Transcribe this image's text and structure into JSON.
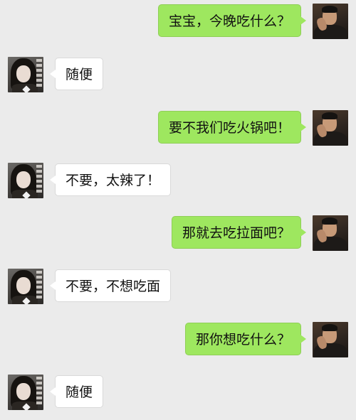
{
  "chat": {
    "messages": [
      {
        "sender": "me",
        "text": "宝宝，今晚吃什么？"
      },
      {
        "sender": "other",
        "text": "随便"
      },
      {
        "sender": "me",
        "text": "要不我们吃火锅吧！"
      },
      {
        "sender": "other",
        "text": "不要，太辣了！"
      },
      {
        "sender": "me",
        "text": "那就去吃拉面吧？"
      },
      {
        "sender": "other",
        "text": "不要，不想吃面"
      },
      {
        "sender": "me",
        "text": "那你想吃什么？"
      },
      {
        "sender": "other",
        "text": "随便"
      }
    ]
  },
  "colors": {
    "background": "#ebebeb",
    "sent_bubble": "#9ee75f",
    "received_bubble": "#ffffff"
  },
  "icons": {
    "me_avatar": "male-avatar-icon",
    "other_avatar": "female-avatar-icon"
  }
}
